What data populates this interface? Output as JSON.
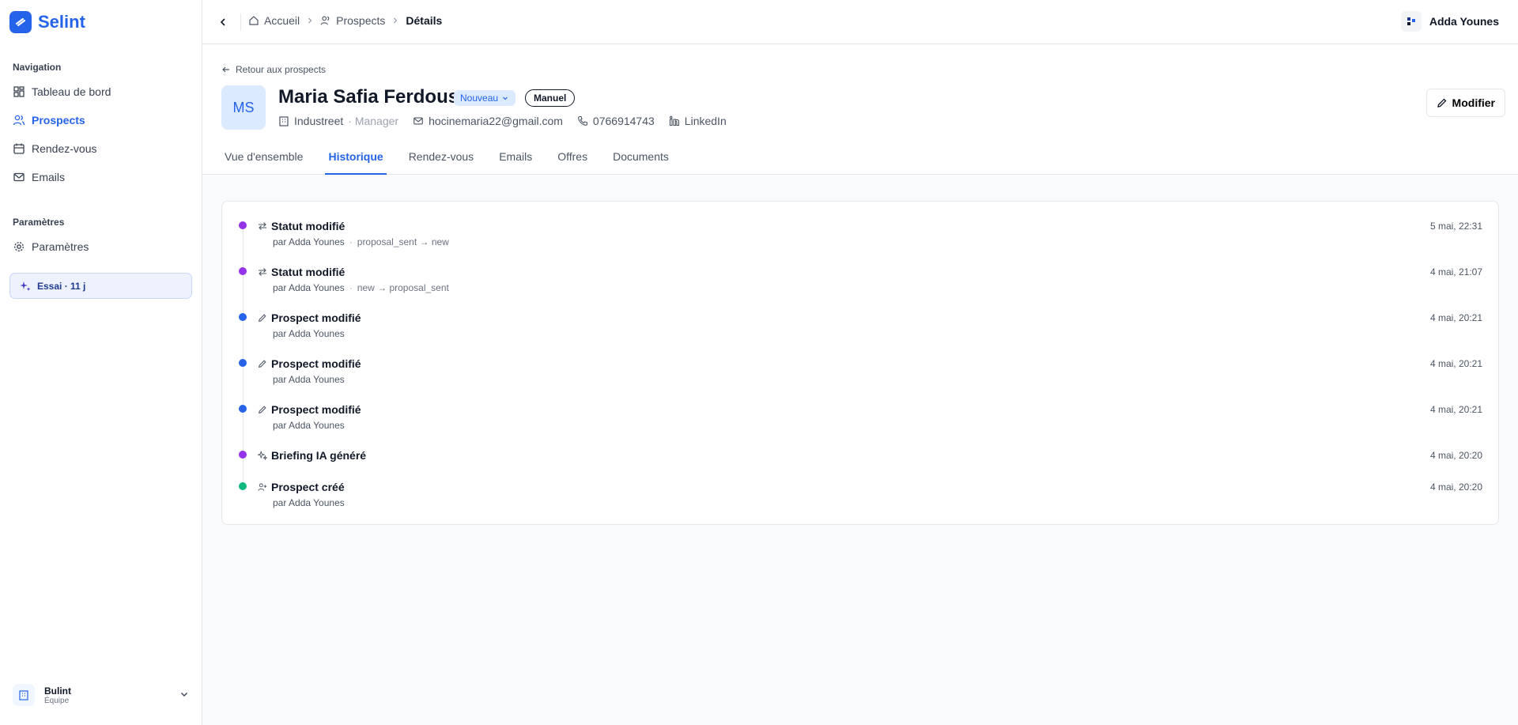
{
  "app": {
    "name": "Selint"
  },
  "sidebar": {
    "nav_title": "Navigation",
    "items": [
      {
        "label": "Tableau de bord",
        "icon": "dashboard-icon"
      },
      {
        "label": "Prospects",
        "icon": "users-icon"
      },
      {
        "label": "Rendez-vous",
        "icon": "calendar-icon"
      },
      {
        "label": "Emails",
        "icon": "mail-icon"
      }
    ],
    "settings_title": "Paramètres",
    "settings_item": {
      "label": "Paramètres",
      "icon": "gear-icon"
    },
    "trial": "Essai · 11 j",
    "team": {
      "name": "Bulint",
      "role": "Équipe"
    }
  },
  "topbar": {
    "breadcrumbs": [
      "Accueil",
      "Prospects",
      "Détails"
    ],
    "user": "Adda Younes"
  },
  "prospect": {
    "back_link": "Retour aux prospects",
    "initials": "MS",
    "name": "Maria Safia Ferdous",
    "status": "Nouveau",
    "source": "Manuel",
    "company": "Industreet",
    "role": "· Manager",
    "email": "hocinemaria22@gmail.com",
    "phone": "0766914743",
    "linkedin": "LinkedIn",
    "edit_label": "Modifier"
  },
  "tabs": [
    "Vue d'ensemble",
    "Historique",
    "Rendez-vous",
    "Emails",
    "Offres",
    "Documents"
  ],
  "colors": {
    "accent": "#2563eb",
    "purple": "#9333ea",
    "blue": "#2563eb",
    "green": "#10b981"
  },
  "timeline": [
    {
      "title": "Statut modifié",
      "by": "par Adda Younes",
      "detail": "proposal_sent → new",
      "time": "5 mai, 22:31",
      "dot": "purple",
      "icon": "swap-icon"
    },
    {
      "title": "Statut modifié",
      "by": "par Adda Younes",
      "detail": "new → proposal_sent",
      "time": "4 mai, 21:07",
      "dot": "purple",
      "icon": "swap-icon"
    },
    {
      "title": "Prospect modifié",
      "by": "par Adda Younes",
      "detail": "",
      "time": "4 mai, 20:21",
      "dot": "blue",
      "icon": "pencil-icon"
    },
    {
      "title": "Prospect modifié",
      "by": "par Adda Younes",
      "detail": "",
      "time": "4 mai, 20:21",
      "dot": "blue",
      "icon": "pencil-icon"
    },
    {
      "title": "Prospect modifié",
      "by": "par Adda Younes",
      "detail": "",
      "time": "4 mai, 20:21",
      "dot": "blue",
      "icon": "pencil-icon"
    },
    {
      "title": "Briefing IA généré",
      "by": "",
      "detail": "",
      "time": "4 mai, 20:20",
      "dot": "purple",
      "icon": "sparkles-icon"
    },
    {
      "title": "Prospect créé",
      "by": "par Adda Younes",
      "detail": "",
      "time": "4 mai, 20:20",
      "dot": "green",
      "icon": "user-plus-icon"
    }
  ]
}
